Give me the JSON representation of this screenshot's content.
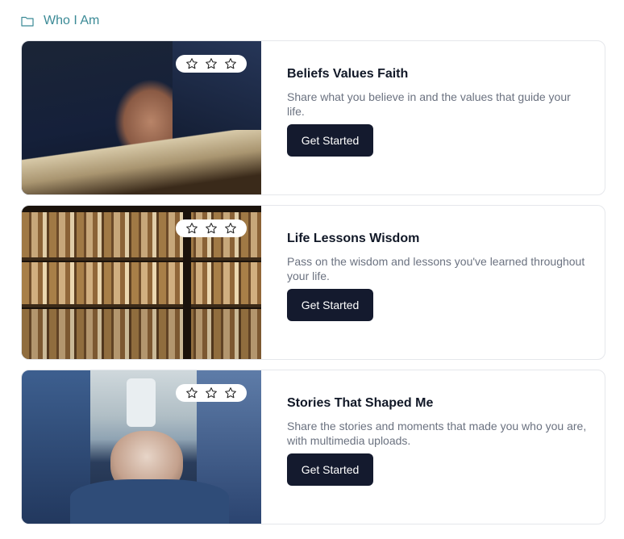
{
  "section": {
    "title": "Who I Am",
    "icon": "folder-icon"
  },
  "colors": {
    "accent": "#3b8a96",
    "button_bg": "#141a2e",
    "desc_text": "#6b7280"
  },
  "cards": [
    {
      "title": "Beliefs Values Faith",
      "description": "Share what you believe in and the values that guide your life.",
      "button_label": "Get Started",
      "rating": {
        "stars": 3,
        "filled": 0
      }
    },
    {
      "title": "Life Lessons Wisdom",
      "description": "Pass on the wisdom and lessons you've learned throughout your life.",
      "button_label": "Get Started",
      "rating": {
        "stars": 3,
        "filled": 0
      }
    },
    {
      "title": "Stories That Shaped Me",
      "description": "Share the stories and moments that made you who you are, with multimedia uploads.",
      "button_label": "Get Started",
      "rating": {
        "stars": 3,
        "filled": 0
      }
    }
  ]
}
